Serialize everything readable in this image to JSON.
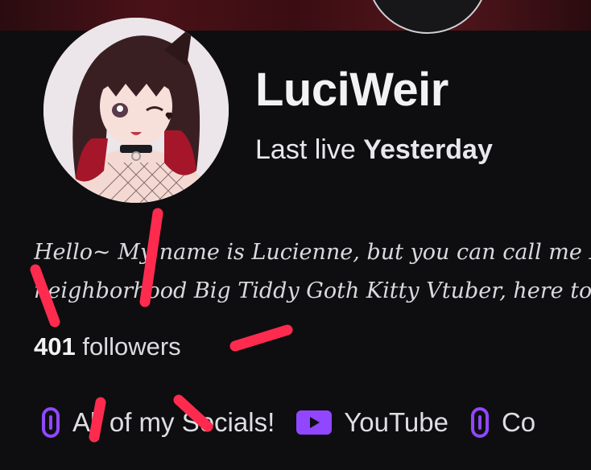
{
  "profile": {
    "channel_name": "LuciWeir",
    "last_live_prefix": "Last live",
    "last_live_value": "Yesterday",
    "bio_lines": [
      "Hello~ My name is Lucienne, but you can call me Lu",
      "neighborhood Big Tiddy Goth Kitty Vtuber, here to m"
    ],
    "followers_count": "401",
    "followers_label": "followers"
  },
  "socials": [
    {
      "label": "All of my Socials!",
      "icon": "link-icon"
    },
    {
      "label": "YouTube",
      "icon": "youtube-icon"
    },
    {
      "label": "Co",
      "icon": "link-icon"
    }
  ],
  "colors": {
    "accent_purple": "#9147ff",
    "background": "#0e0e10",
    "annotation_red": "#ff2b4f"
  }
}
